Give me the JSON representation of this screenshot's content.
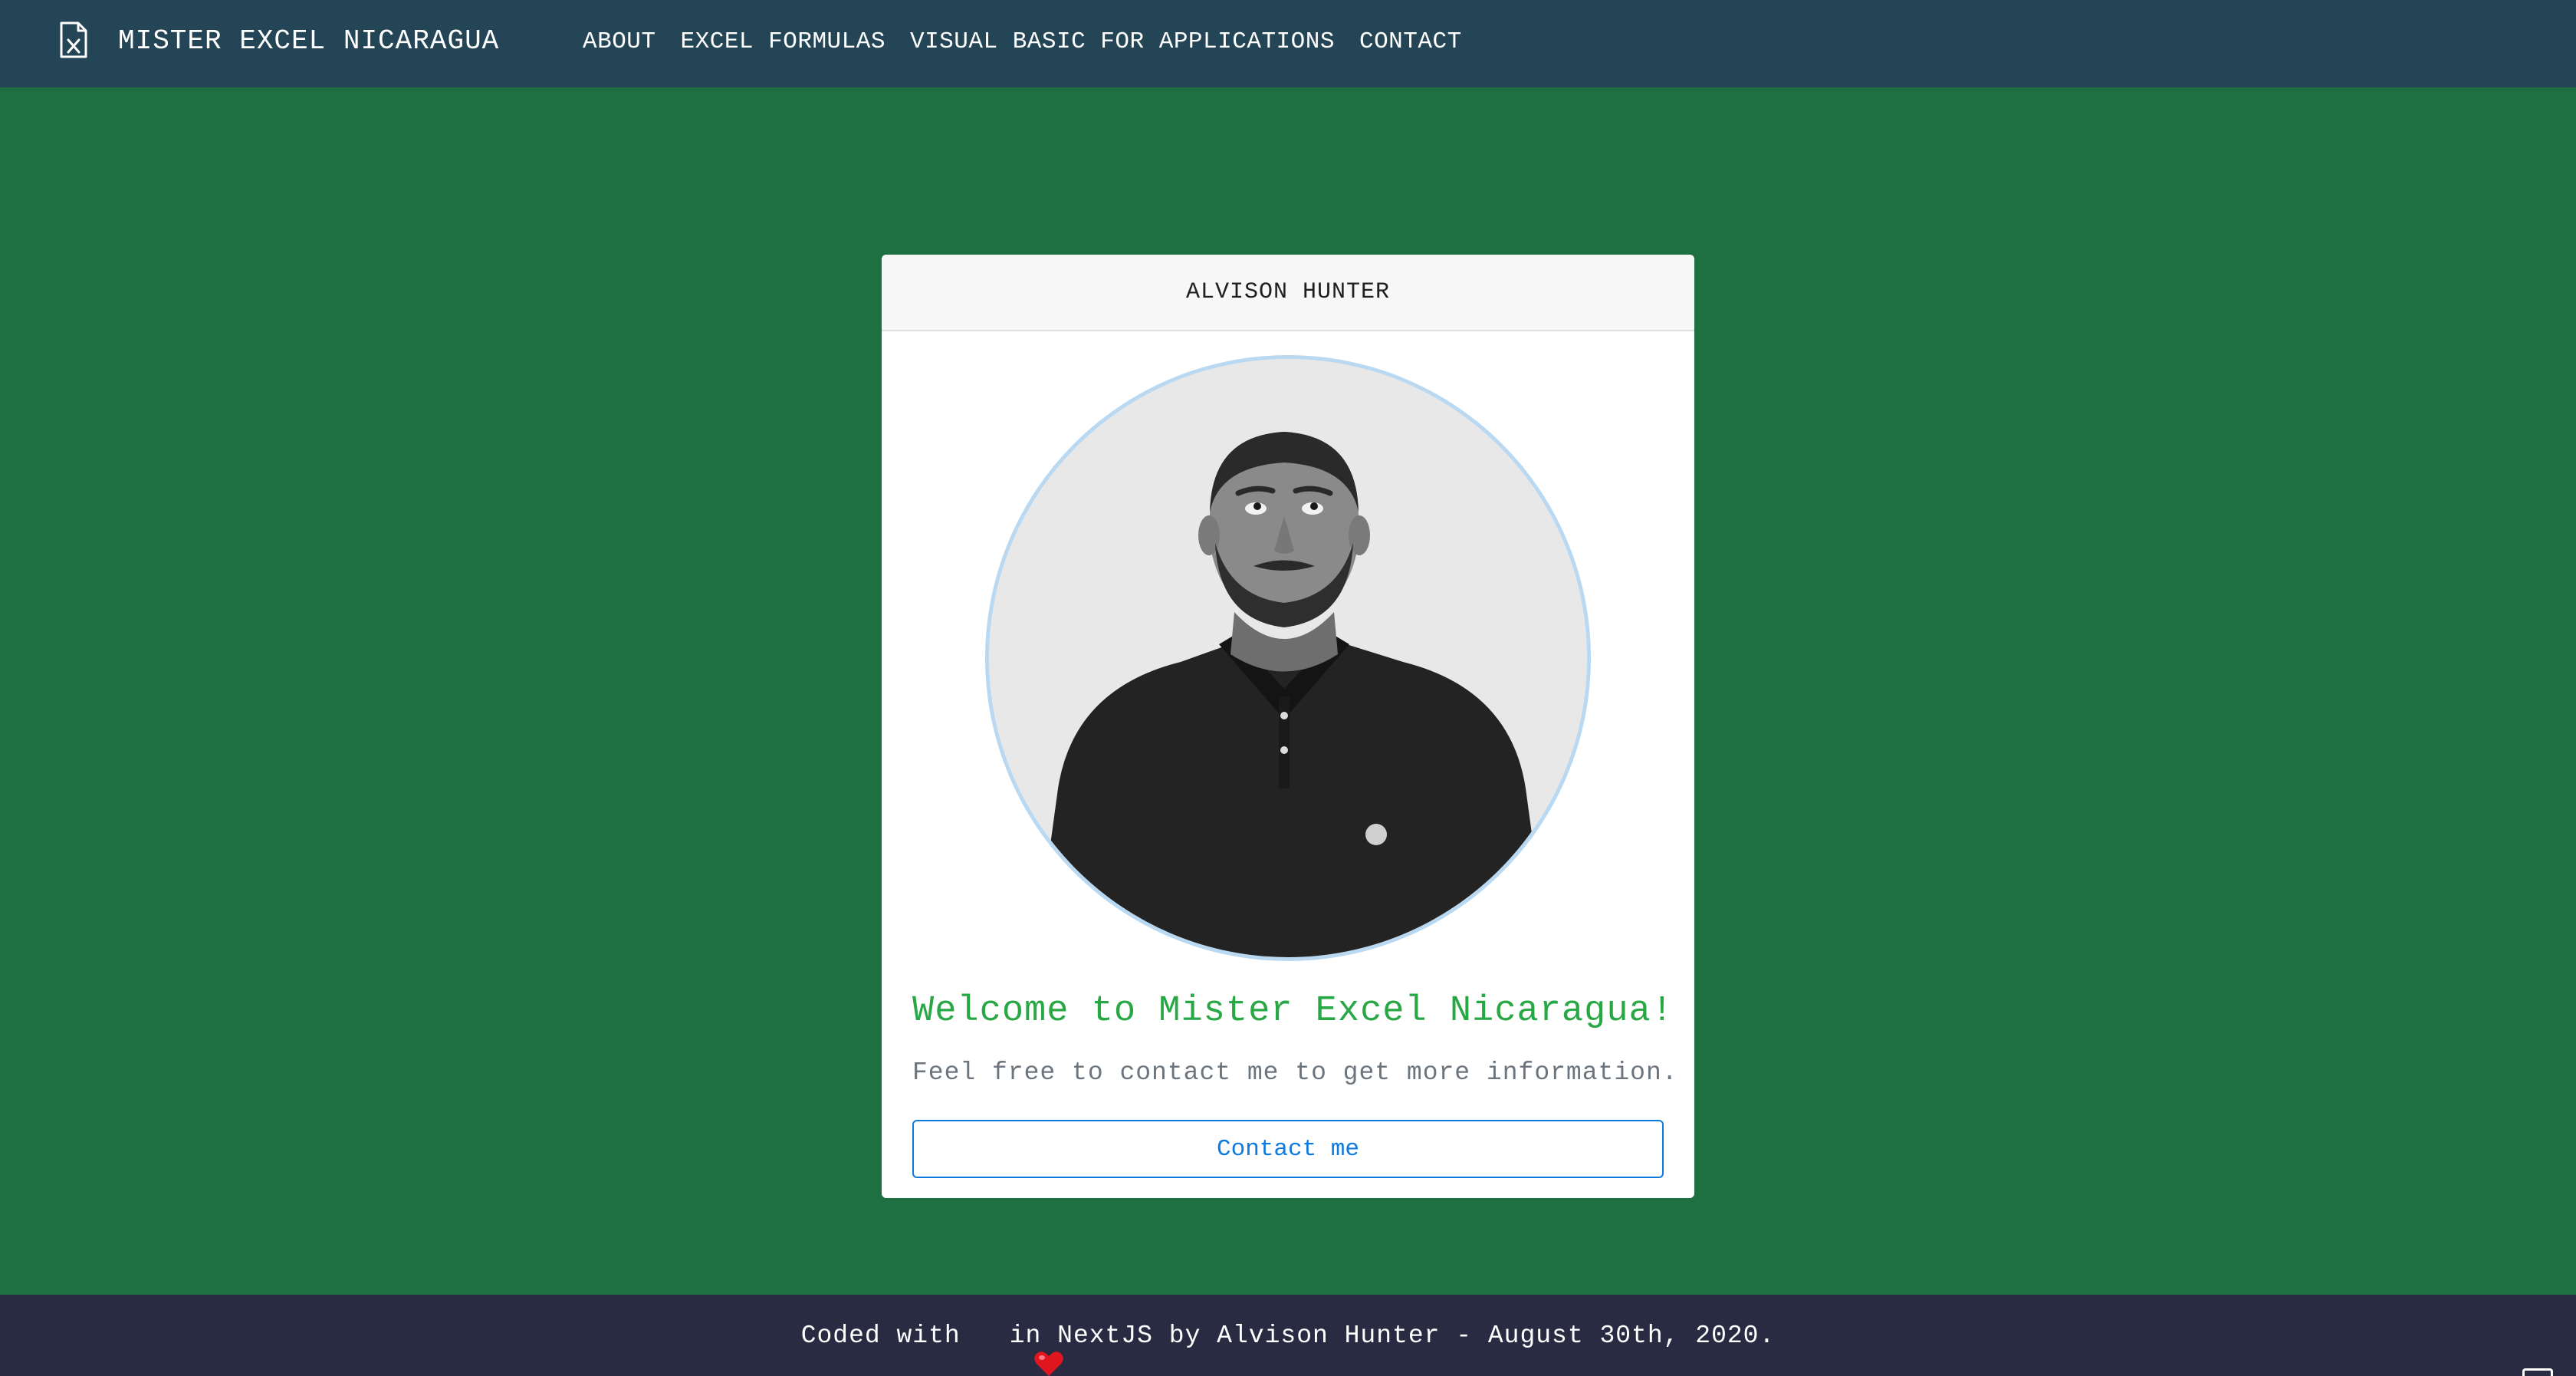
{
  "navbar": {
    "brand_icon": "excel-file-icon",
    "brand_title": "MISTER EXCEL NICARAGUA",
    "links": [
      "ABOUT",
      "EXCEL FORMULAS",
      "VISUAL BASIC FOR APPLICATIONS",
      "CONTACT"
    ]
  },
  "card": {
    "header": "ALVISON HUNTER",
    "title": "Welcome to Mister Excel Nicaragua!",
    "text": "Feel free to contact me to get more information.",
    "button_label": "Contact me"
  },
  "footer": {
    "prefix": "Coded with",
    "heart_icon": "heart-icon",
    "suffix": "in NextJS by Alvison Hunter - August 30th, 2020."
  },
  "colors": {
    "page_bg": "#1e7043",
    "navbar_bg": "#244555",
    "footer_bg": "#282b42",
    "title_green": "#28a745",
    "button_blue": "#0d7ae0"
  }
}
